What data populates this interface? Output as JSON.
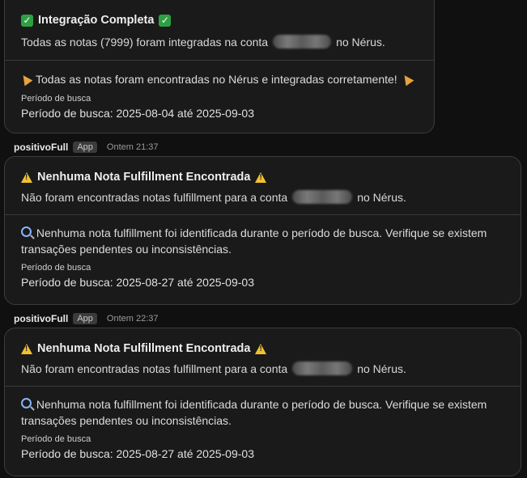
{
  "messages": [
    {
      "title": "Integração Completa",
      "line_before": "Todas as notas (7999) foram integradas na conta",
      "line_after": "no Nérus.",
      "note": "Todas as notas foram encontradas no Nérus e integradas corretamente!",
      "period_label": "Período de busca",
      "period_value": "Período de busca: 2025-08-04 até 2025-09-03"
    },
    {
      "author": "positivoFull",
      "badge": "App",
      "time": "Ontem 21:37",
      "title": "Nenhuma Nota Fulfillment Encontrada",
      "line_before": "Não foram encontradas notas fulfillment para a conta",
      "line_after": "no Nérus.",
      "note": "Nenhuma nota fulfillment foi identificada durante o período de busca. Verifique se existem transações pendentes ou inconsistências.",
      "period_label": "Período de busca",
      "period_value": "Período de busca: 2025-08-27 até 2025-09-03"
    },
    {
      "author": "positivoFull",
      "badge": "App",
      "time": "Ontem 22:37",
      "title": "Nenhuma Nota Fulfillment Encontrada",
      "line_before": "Não foram encontradas notas fulfillment para a conta",
      "line_after": "no Nérus.",
      "note": "Nenhuma nota fulfillment foi identificada durante o período de busca. Verifique se existem transações pendentes ou inconsistências.",
      "period_label": "Período de busca",
      "period_value": "Período de busca: 2025-08-27 até 2025-09-03"
    }
  ],
  "icons": {
    "success": "check-mark-icon",
    "warning": "warning-icon",
    "search": "magnifying-glass-icon",
    "party": "party-popper-icon"
  },
  "colors": {
    "background": "#101010",
    "card": "#1a1a1a",
    "success": "#2ea043",
    "warning": "#f2c12e"
  }
}
